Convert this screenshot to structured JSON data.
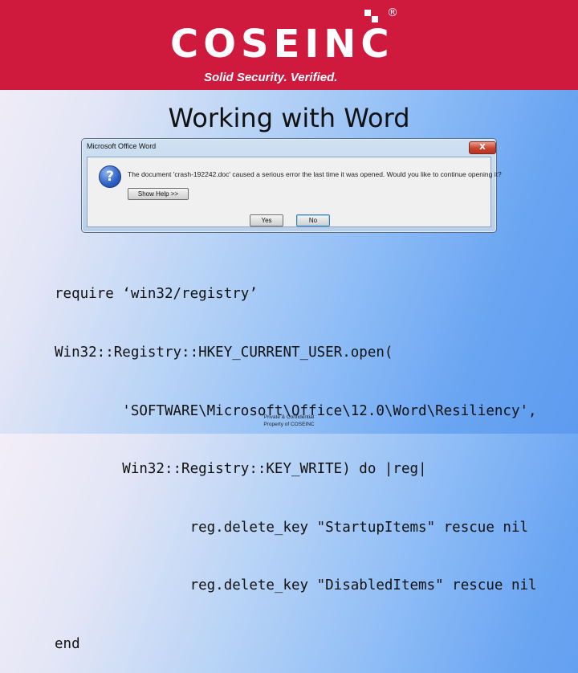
{
  "header": {
    "logo_text": "COSEINC",
    "registered_mark": "®",
    "tagline": "Solid Security. Verified.",
    "background_color": "#cf1a3e"
  },
  "slide": {
    "title": "Working with Word"
  },
  "dialog": {
    "title": "Microsoft Office Word",
    "close_label": "X",
    "icon": "question-icon",
    "message": "The document 'crash-192242.doc' caused a serious error the last time it was opened. Would you like to continue opening it?",
    "show_help_label": "Show Help >>",
    "yes_label": "Yes",
    "no_label": "No"
  },
  "code": {
    "lines": [
      "require ‘win32/registry’",
      "Win32::Registry::HKEY_CURRENT_USER.open(",
      "        'SOFTWARE\\Microsoft\\Office\\12.0\\Word\\Resiliency',",
      "        Win32::Registry::KEY_WRITE) do |reg|",
      "                reg.delete_key \"StartupItems\" rescue nil",
      "                reg.delete_key \"DisabledItems\" rescue nil",
      "end"
    ]
  },
  "footer": {
    "line1": "Private & Confidential",
    "line2": "Property of COSEINC"
  }
}
